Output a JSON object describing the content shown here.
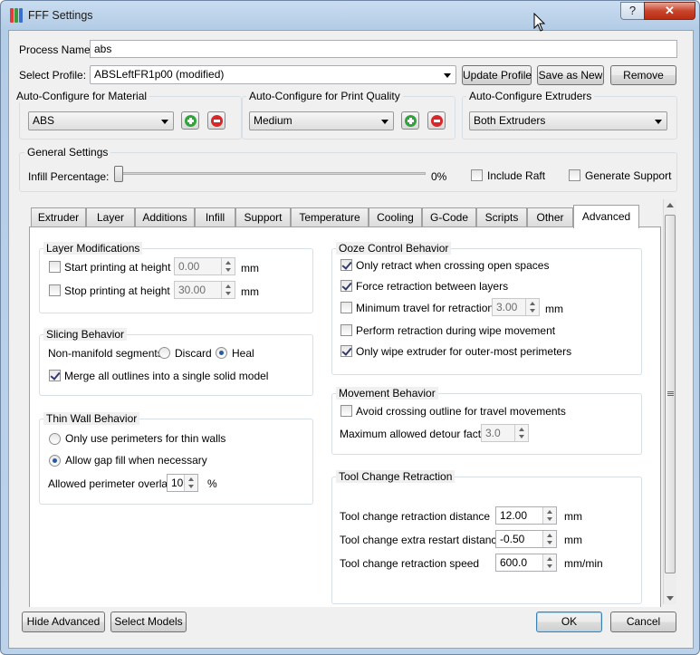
{
  "window": {
    "title": "FFF Settings",
    "help_button": "?",
    "close_button": "✕",
    "icon_colors": [
      "#e33b3b",
      "#3b9b3b",
      "#3b6fcc"
    ]
  },
  "process_name": {
    "label": "Process Name:",
    "value": "abs"
  },
  "profile": {
    "label": "Select Profile:",
    "value": "ABSLeftFR1p00 (modified)",
    "update_label": "Update Profile",
    "save_as_label": "Save as New",
    "remove_label": "Remove"
  },
  "auto_material": {
    "title": "Auto-Configure for Material",
    "value": "ABS"
  },
  "auto_quality": {
    "title": "Auto-Configure for Print Quality",
    "value": "Medium"
  },
  "auto_extruders": {
    "title": "Auto-Configure Extruders",
    "value": "Both Extruders"
  },
  "general": {
    "title": "General Settings",
    "infill_label": "Infill Percentage:",
    "infill_value": "0%",
    "infill_fraction": 0,
    "include_raft": "Include Raft",
    "include_raft_checked": false,
    "generate_support": "Generate Support",
    "generate_support_checked": false
  },
  "tabs": [
    "Extruder",
    "Layer",
    "Additions",
    "Infill",
    "Support",
    "Temperature",
    "Cooling",
    "G-Code",
    "Scripts",
    "Other",
    "Advanced"
  ],
  "active_tab": "Advanced",
  "layer_mod": {
    "title": "Layer Modifications",
    "start_label": "Start printing at height",
    "start_value": "0.00",
    "start_unit": "mm",
    "stop_label": "Stop printing at height",
    "stop_value": "30.00",
    "stop_unit": "mm"
  },
  "slicing": {
    "title": "Slicing Behavior",
    "nonmanifold_label": "Non-manifold segments:",
    "discard_label": "Discard",
    "heal_label": "Heal",
    "selected": "Heal",
    "merge_label": "Merge all outlines into a single solid model",
    "merge_checked": true
  },
  "thin_wall": {
    "title": "Thin Wall Behavior",
    "option1": "Only use perimeters for thin walls",
    "option2": "Allow gap fill when necessary",
    "selected": "Allow gap fill when necessary",
    "overlap_label": "Allowed perimeter overlap",
    "overlap_value": "10",
    "overlap_unit": "%"
  },
  "ooze": {
    "title": "Ooze Control Behavior",
    "only_retract": "Only retract when crossing open spaces",
    "only_retract_checked": true,
    "force_retract": "Force retraction between layers",
    "force_retract_checked": true,
    "min_travel": "Minimum travel for retraction",
    "min_travel_checked": false,
    "min_travel_value": "3.00",
    "min_travel_unit": "mm",
    "wipe_retract": "Perform retraction during wipe movement",
    "wipe_retract_checked": false,
    "only_wipe": "Only wipe extruder for outer-most perimeters",
    "only_wipe_checked": true
  },
  "movement": {
    "title": "Movement Behavior",
    "avoid_label": "Avoid crossing outline for travel movements",
    "avoid_checked": false,
    "detour_label": "Maximum allowed detour factor",
    "detour_value": "3.0"
  },
  "tool_change": {
    "title": "Tool Change Retraction",
    "distance_label": "Tool change retraction distance",
    "distance_value": "12.00",
    "distance_unit": "mm",
    "extra_label": "Tool change extra restart distance",
    "extra_value": "-0.50",
    "extra_unit": "mm",
    "speed_label": "Tool change retraction speed",
    "speed_value": "600.0",
    "speed_unit": "mm/min"
  },
  "footer": {
    "hide_advanced": "Hide Advanced",
    "select_models": "Select Models",
    "ok": "OK",
    "cancel": "Cancel"
  }
}
